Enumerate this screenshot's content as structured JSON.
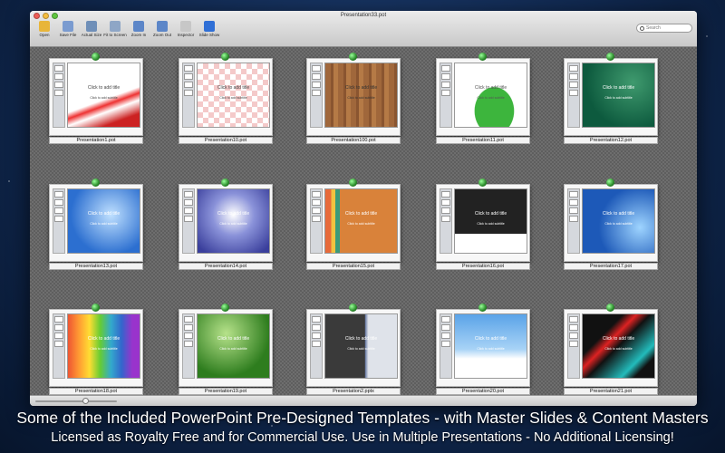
{
  "window": {
    "title": "Presentation33.pot"
  },
  "toolbar": {
    "items": [
      {
        "label": "Open",
        "icon": "folder-icon",
        "color": "#e8b53a"
      },
      {
        "label": "Save File",
        "icon": "save-icon",
        "color": "#7a9bd0"
      },
      {
        "label": "Actual Size",
        "icon": "actual-size-icon",
        "color": "#6f8fb8"
      },
      {
        "label": "Fit to Screen",
        "icon": "fit-screen-icon",
        "color": "#8ea6c6"
      },
      {
        "label": "Zoom In",
        "icon": "zoom-in-icon",
        "color": "#5c86c8"
      },
      {
        "label": "Zoom Out",
        "icon": "zoom-out-icon",
        "color": "#5c86c8"
      },
      {
        "label": "Inspector",
        "icon": "inspector-icon",
        "color": "#c7c7c7"
      },
      {
        "label": "Slide Show",
        "icon": "slideshow-icon",
        "color": "#2f6fd6"
      }
    ],
    "search_placeholder": "Search"
  },
  "zoom_slider": {
    "value": 0.62
  },
  "slide_text": {
    "title": "Click to add title",
    "subtitle": "Click to add subtitle"
  },
  "templates": [
    {
      "name": "Presentation1.pot",
      "bg": "linear-gradient(160deg,#fff 55%,#e33 62%,#fff 70%,#c22 85%)",
      "text": "#444"
    },
    {
      "name": "Presentation10.pot",
      "bg": "repeating-conic-gradient(#f4c9c9 0 25%,#fff 0 50%) 0 0/12px 12px",
      "text": "#444"
    },
    {
      "name": "Presentation100.pot",
      "bg": "repeating-linear-gradient(90deg,#a0673b 0 6px,#8a5530 6px 9px,#b57a46 9px 14px)",
      "text": "#333"
    },
    {
      "name": "Presentation11.pot",
      "bg": "radial-gradient(ellipse at 55% 75%,#3db53d 0 35%,#fff 36%)",
      "text": "#555"
    },
    {
      "name": "Presentation12.pot",
      "bg": "radial-gradient(circle at 70% 30%,#3f9a6e,#0d5a3e 70%)",
      "text": "#fff"
    },
    {
      "name": "Presentation13.pot",
      "bg": "radial-gradient(circle at 60% 40%,#bfe0ff,#2c6fd0 70%)",
      "text": "#fff"
    },
    {
      "name": "Presentation14.pot",
      "bg": "radial-gradient(circle at 50% 40%,#fff,#8a92d9 40%,#3a3f9c 90%)",
      "text": "#fff"
    },
    {
      "name": "Presentation15.pot",
      "bg": "linear-gradient(90deg,#e76a3a 0 8%,#f3c240 8% 14%,#3c9a7a 14% 20%,#d9823a 20%)",
      "text": "#fff"
    },
    {
      "name": "Presentation16.pot",
      "bg": "linear-gradient(#222 70%,#fff 70%)",
      "text": "#fff"
    },
    {
      "name": "Presentation17.pot",
      "bg": "radial-gradient(circle at 80% 60%,#9ed4ff,#1d59b8 60%)",
      "text": "#fff"
    },
    {
      "name": "Presentation18.pot",
      "bg": "linear-gradient(90deg,#e53 0,#f93 15%,#fd3 30%,#6c3 45%,#3ac 60%,#36c 75%,#93c 90%)",
      "text": "#fff"
    },
    {
      "name": "Presentation19.pot",
      "bg": "radial-gradient(circle at 40% 30%,#b6e28a,#2e7d1e 70%)",
      "text": "#fff"
    },
    {
      "name": "Presentation2.pptx",
      "bg": "linear-gradient(90deg,#3a3a3a 55%,#6d7fa8 56%,#dfe3ea 60%)",
      "text": "#fff"
    },
    {
      "name": "Presentation20.pot",
      "bg": "linear-gradient(#5aa3e8 0,#a8d3f6 55%,#fff 70%)",
      "text": "#fff"
    },
    {
      "name": "Presentation21.pot",
      "bg": "linear-gradient(135deg,#111 30%,#d22 40%,#111 50%,#2bb 75%,#111 85%)",
      "text": "#fff"
    }
  ],
  "captions": {
    "line1": "Some of the Included PowerPoint Pre-Designed  Templates - with Master Slides & Content Masters",
    "line2": "Licensed as Royalty Free and for Commercial Use.  Use in Multiple Presentations - No Additional Licensing!"
  }
}
